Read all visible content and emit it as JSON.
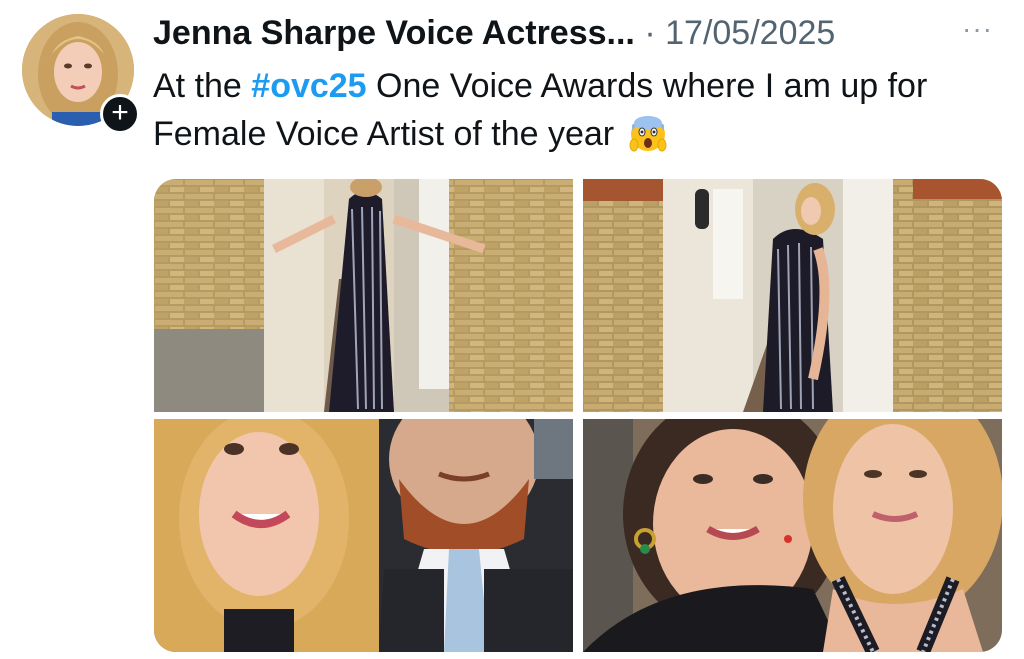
{
  "author": {
    "display_name": "Jenna Sharpe Voice Actress...",
    "separator": "·",
    "date": "17/05/2025",
    "follow_badge": "+"
  },
  "post": {
    "text_before": "At the ",
    "hashtag": "#ovc25",
    "text_after": " One Voice Awards where I am up for Female Voice Artist of the year",
    "emoji_icon": "face-screaming-in-fear-icon"
  },
  "menu": {
    "more_label": "···"
  },
  "media": {
    "photos": [
      {
        "description_icon": "photo-sequin-gown-front"
      },
      {
        "description_icon": "photo-sequin-gown-back"
      },
      {
        "description_icon": "photo-selfie-with-man"
      },
      {
        "description_icon": "photo-selfie-with-woman"
      }
    ]
  },
  "colors": {
    "accent": "#1d9bf0",
    "text": "#0f1419",
    "muted": "#536471"
  }
}
